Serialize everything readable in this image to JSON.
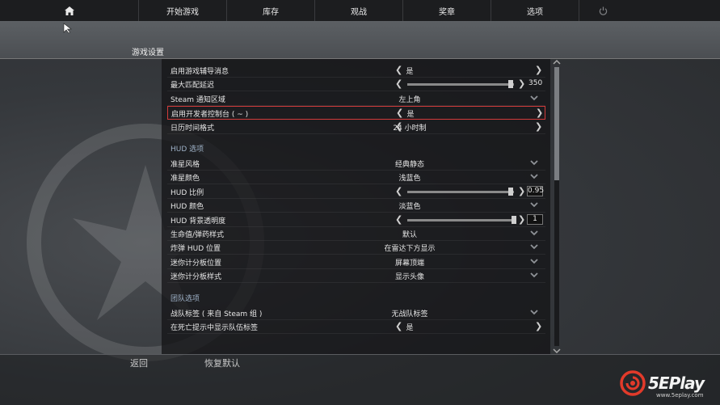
{
  "nav": {
    "items": [
      "开始游戏",
      "库存",
      "观战",
      "奖章",
      "选项"
    ],
    "home_icon": "home-icon",
    "power_icon": "power-icon"
  },
  "page": {
    "title": "游戏设置"
  },
  "rows_top": [
    {
      "label": "启用游戏辅导消息",
      "type": "arrows",
      "value": "是"
    },
    {
      "label": "最大匹配延迟",
      "type": "slider",
      "value": "350",
      "level": 0.97
    },
    {
      "label": "Steam 通知区域",
      "type": "dropdown",
      "value": "左上角"
    },
    {
      "label": "启用开发者控制台 ( ~ )",
      "type": "arrows",
      "value": "是",
      "highlighted": true
    },
    {
      "label": "日历时间格式",
      "type": "arrows",
      "value": "24 小时制"
    }
  ],
  "hud_section": {
    "title": "HUD 选项"
  },
  "rows_hud": [
    {
      "label": "准星风格",
      "type": "dropdown",
      "value": "经典静态"
    },
    {
      "label": "准星颜色",
      "type": "dropdown",
      "value": "浅蓝色"
    },
    {
      "label": "HUD 比例",
      "type": "slider",
      "value": "0.95",
      "level": 0.97
    },
    {
      "label": "HUD 颜色",
      "type": "dropdown",
      "value": "淡蓝色"
    },
    {
      "label": "HUD 背景透明度",
      "type": "slider",
      "value": "1",
      "level": 1.0
    },
    {
      "label": "生命值/弹药样式",
      "type": "dropdown",
      "value": "默认"
    },
    {
      "label": "炸弹 HUD 位置",
      "type": "dropdown",
      "value": "在雷达下方显示"
    },
    {
      "label": "迷你计分板位置",
      "type": "dropdown",
      "value": "屏幕顶端"
    },
    {
      "label": "迷你计分板样式",
      "type": "dropdown",
      "value": "显示头像"
    }
  ],
  "team_section": {
    "title": "团队选项"
  },
  "rows_team": [
    {
      "label": "战队标签 ( 来自 Steam 组 )",
      "type": "dropdown",
      "value": "无战队标签"
    },
    {
      "label": "在死亡提示中显示队伍标签",
      "type": "arrows",
      "value": "是"
    }
  ],
  "bottom": {
    "back": "返回",
    "reset": "恢复默认"
  },
  "watermark": {
    "brand": "5EPlay",
    "url": "www.5eplay.com"
  },
  "colors": {
    "highlight": "#d23b3b",
    "section": "#9fb2c8"
  }
}
